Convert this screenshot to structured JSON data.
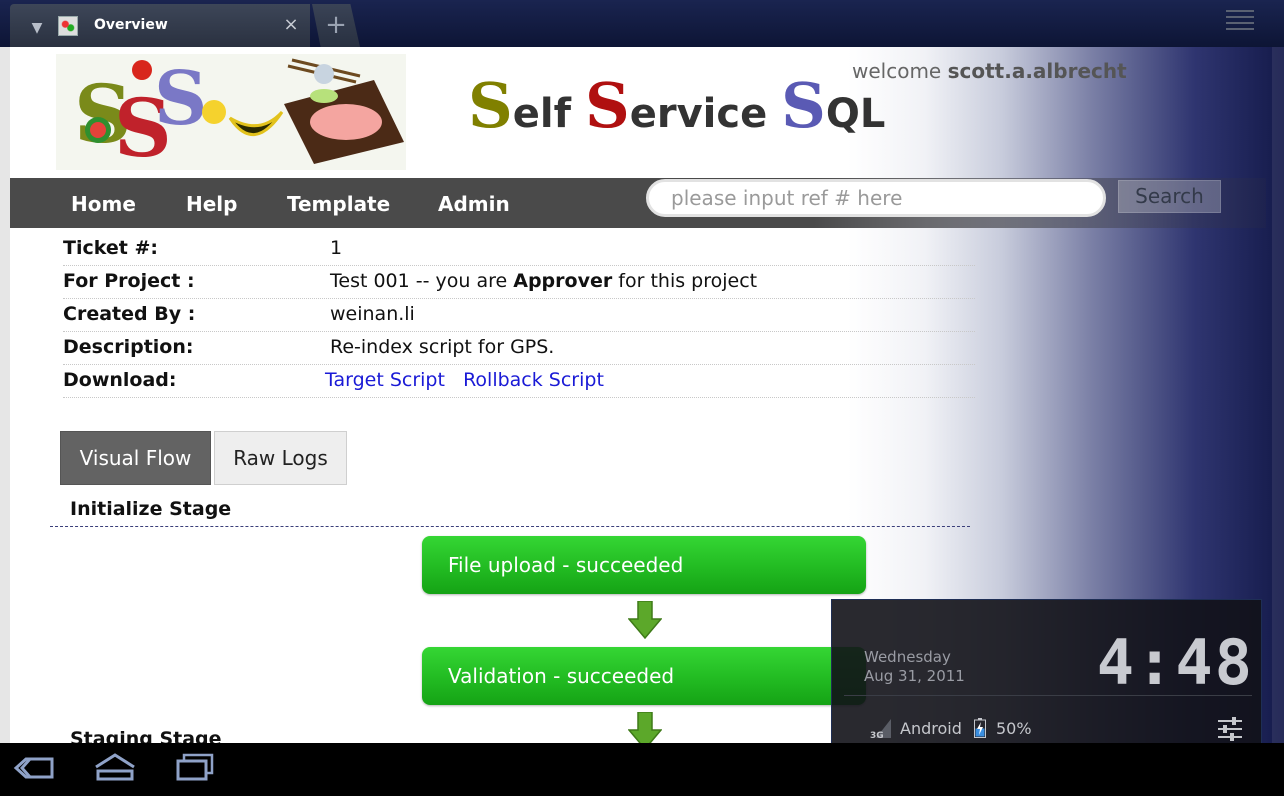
{
  "browser": {
    "tab_title": "Overview",
    "tab_close": "×",
    "new_tab": "+"
  },
  "header": {
    "site_title": {
      "s1": "S",
      "w1": "elf ",
      "s2": "S",
      "w2": "ervice ",
      "s3": "S",
      "w3": "QL"
    },
    "welcome_prefix": "welcome",
    "username": "scott.a.albrecht"
  },
  "nav": {
    "items": [
      "Home",
      "Help",
      "Template",
      "Admin"
    ],
    "search_placeholder": "please input ref # here",
    "search_button": "Search"
  },
  "ticket": {
    "number_label": "Ticket #:",
    "number_value": "1",
    "project_label": "For Project :",
    "project_name": "Test 001 -- you are",
    "project_role": "Approver",
    "project_suffix": "for this project",
    "created_label": "Created By :",
    "created_value": "weinan.li",
    "description_label": "Description:",
    "description_value": "Re-index script for GPS.",
    "download_label": "Download:",
    "download_links": [
      "Target Script",
      "Rollback Script"
    ]
  },
  "tabs": [
    "Visual Flow",
    "Raw Logs"
  ],
  "flow": {
    "initialize_stage": "Initialize Stage",
    "steps": [
      "File upload - succeeded",
      "Validation - succeeded"
    ],
    "staging_stage": "Staging Stage"
  },
  "clock_widget": {
    "day": "Wednesday",
    "date": "Aug 31, 2011",
    "time": "4:48",
    "carrier": "Android",
    "battery": "50%",
    "signal_label": "3G"
  },
  "colors": {
    "step_green": "#22bb22",
    "link_blue": "#1a1ad6",
    "title_s1": "#808000",
    "title_s2": "#b01010",
    "title_s3": "#5a5ab4"
  },
  "icons": [
    "tab-dropdown-icon",
    "favicon",
    "close-icon",
    "plus-icon",
    "menu-icon",
    "signal-3g-icon",
    "battery-icon",
    "settings-sliders-icon",
    "back-icon",
    "home-icon",
    "recent-apps-icon",
    "down-arrow-icon"
  ]
}
